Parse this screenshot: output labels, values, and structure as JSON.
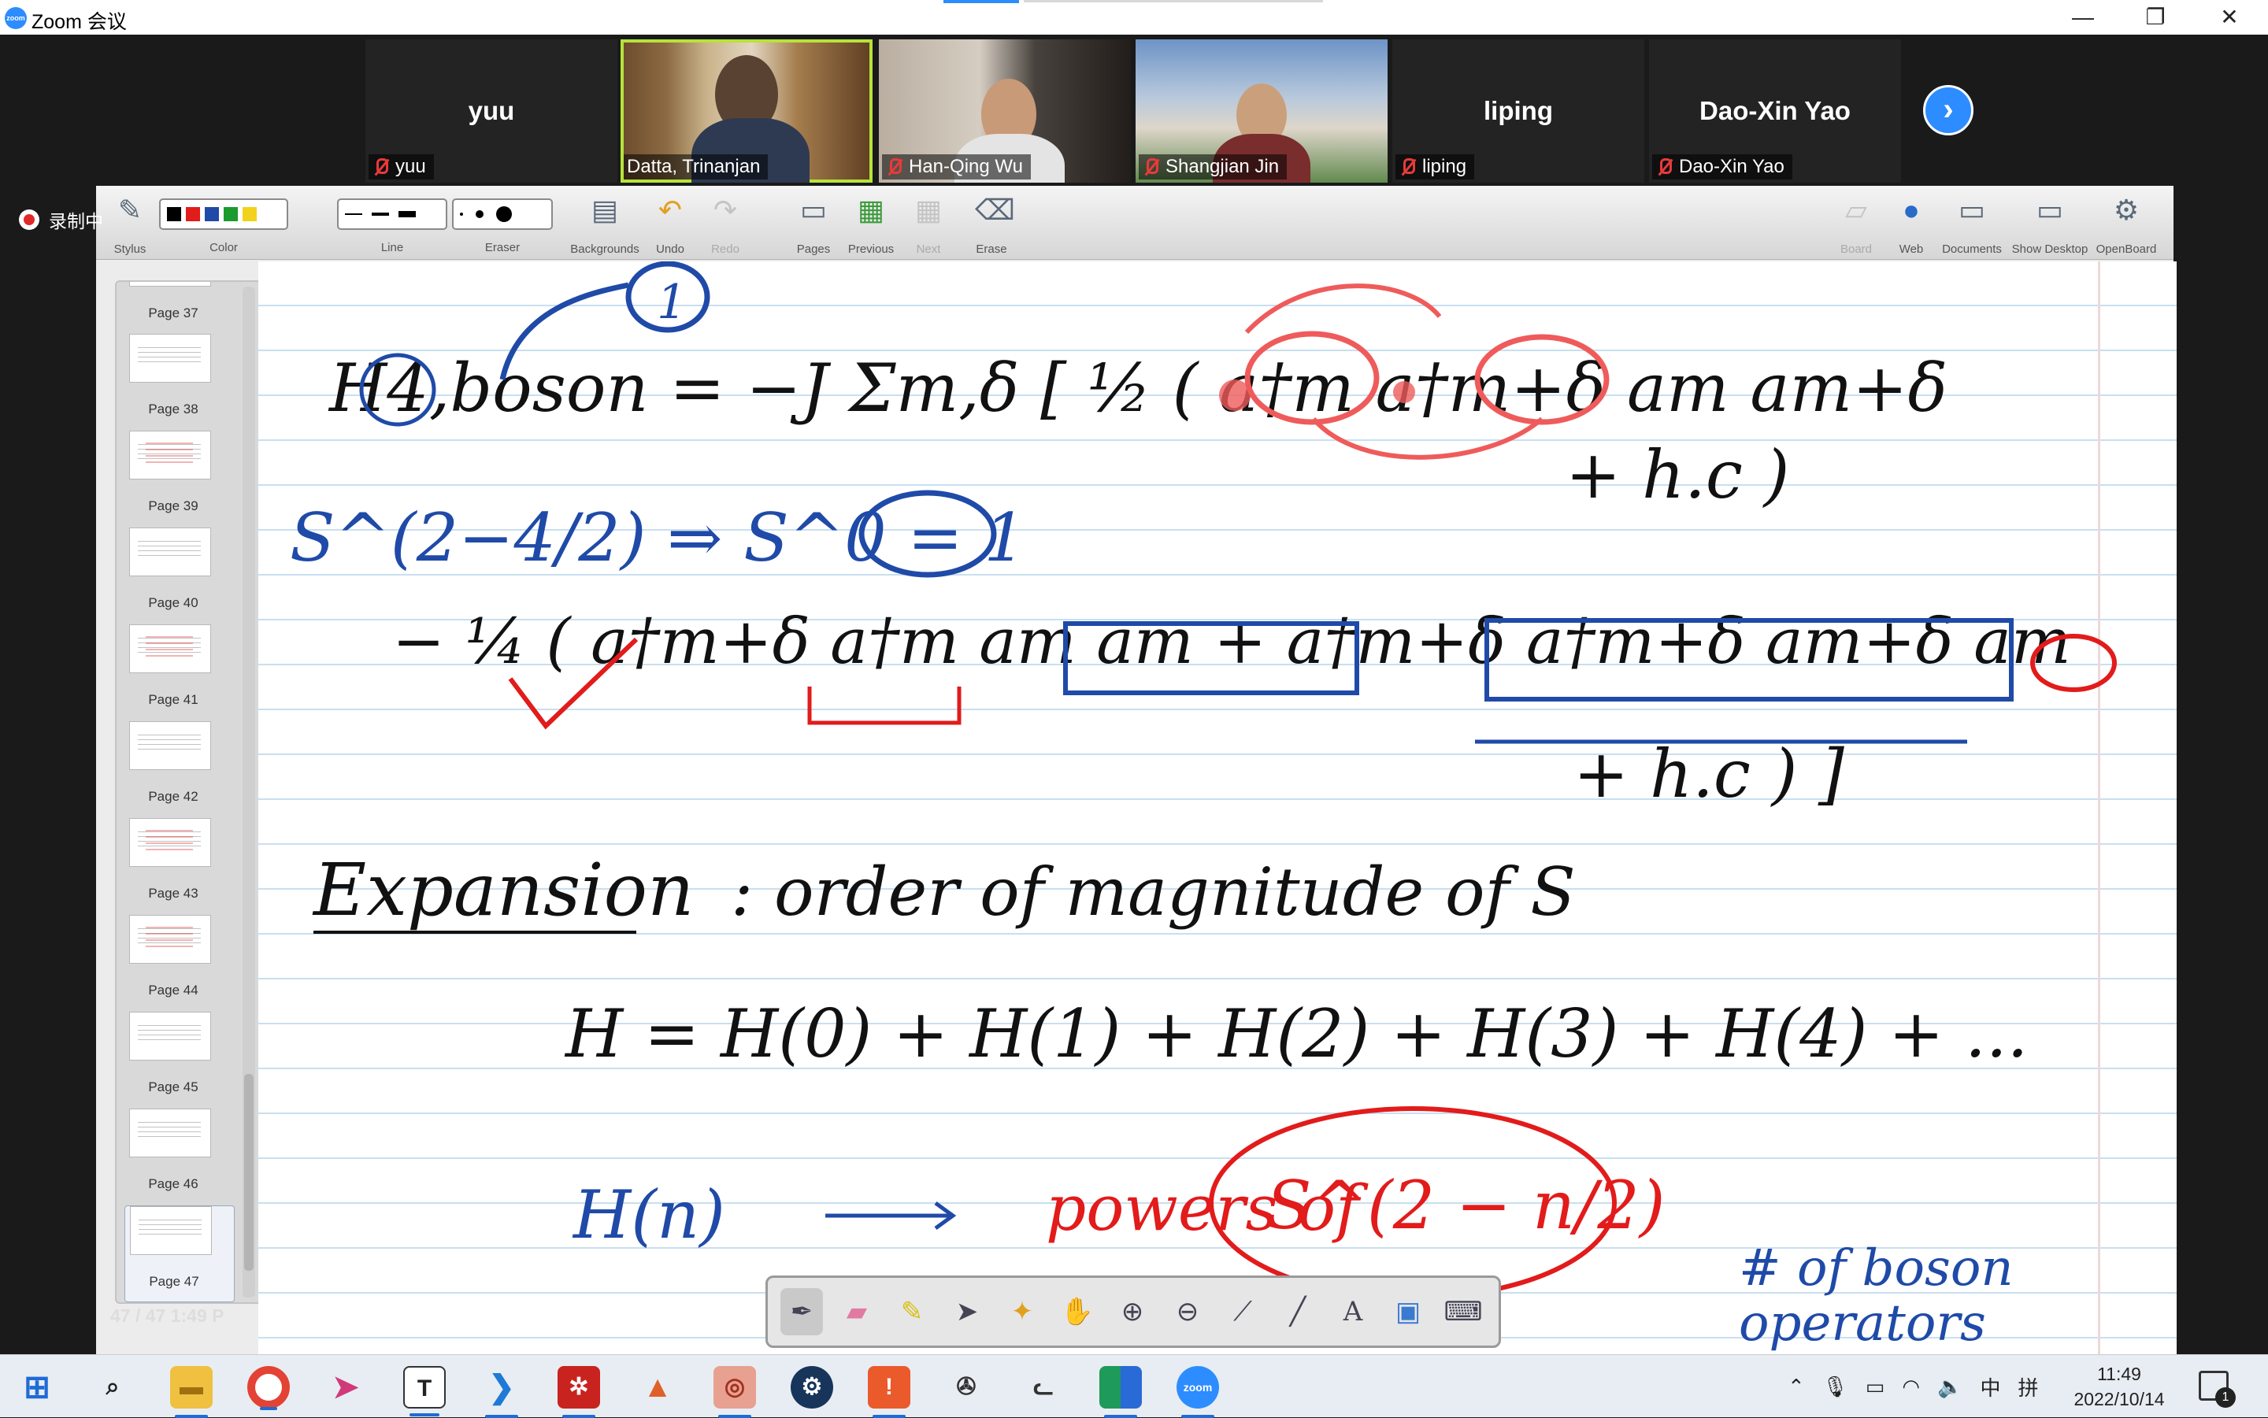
{
  "window": {
    "title": "Zoom 会议",
    "controls": [
      "—",
      "❐",
      "✕"
    ]
  },
  "participants": [
    {
      "name": "yuu",
      "label": "yuu",
      "video": false
    },
    {
      "name": "Datta, Trinanjan",
      "label": "Datta, Trinanjan",
      "video": true,
      "active": true
    },
    {
      "name": "Han-Qing Wu",
      "label": "Han-Qing Wu",
      "video": true
    },
    {
      "name": "Shangjian Jin",
      "label": "Shangjian Jin",
      "video": true
    },
    {
      "name": "liping",
      "label": "liping",
      "video": false
    },
    {
      "name": "Dao-Xin Yao",
      "label": "Dao-Xin Yao",
      "video": false
    }
  ],
  "next_icon": "chevron-right-icon",
  "recording": {
    "label": "录制中"
  },
  "toolbar": {
    "stylus": "Stylus",
    "color": "Color",
    "colors": [
      "#000000",
      "#e21b1b",
      "#1f4aa8",
      "#1b9a2e",
      "#f2d21b"
    ],
    "line": "Line",
    "eraser": "Eraser",
    "backgrounds": "Backgrounds",
    "undo": "Undo",
    "redo": "Redo",
    "pages": "Pages",
    "previous": "Previous",
    "next": "Next",
    "erase": "Erase",
    "board": "Board",
    "web": "Web",
    "documents": "Documents",
    "show_desktop": "Show Desktop",
    "openboard": "OpenBoard"
  },
  "pages": [
    {
      "label": "Page 37"
    },
    {
      "label": "Page 38"
    },
    {
      "label": "Page 39"
    },
    {
      "label": "Page 40"
    },
    {
      "label": "Page 41"
    },
    {
      "label": "Page 42"
    },
    {
      "label": "Page 43"
    },
    {
      "label": "Page 44"
    },
    {
      "label": "Page 45"
    },
    {
      "label": "Page 46"
    },
    {
      "label": "Page 47"
    }
  ],
  "page_indicator": "47 / 47 1:49 P",
  "whiteboard": {
    "line1": "H4,boson = −J Σm,δ [ ½ ( a†m a†m+δ am am+δ",
    "line1b": "+ h.c )",
    "line2": "S^(2−4/2) ⇒ S^0 = 1",
    "line3": "− ¼ ( a†m+δ a†m am am + a†m+δ a†m+δ am+δ am",
    "line3b": "+ h.c ) ]",
    "heading": "Expansion",
    "heading_rest": ": order of magnitude of S",
    "series": "H = H(0) + H(1) + H(2) + H(3) + H(4) + ...",
    "hn": "H(n)",
    "powers": "powers of",
    "circled": "S^(2 − n/2)",
    "note1": "# of boson",
    "note2": "operators"
  },
  "float_tools": [
    "pen-icon",
    "eraser-icon",
    "highlighter-icon",
    "pointer-icon",
    "laser-icon",
    "hand-icon",
    "zoom-in-icon",
    "zoom-out-icon",
    "color-picker-icon",
    "line-icon",
    "text-icon",
    "capture-icon",
    "keyboard-icon"
  ],
  "taskbar": {
    "apps": [
      "windows",
      "search",
      "file-explorer",
      "chrome",
      "app-pink",
      "typora",
      "vscode",
      "app-red",
      "matlab",
      "app-pdf",
      "steam",
      "app-orange",
      "app-wheel",
      "app-cat",
      "app-green",
      "zoom"
    ],
    "tray": {
      "ime1": "中",
      "ime2": "拼"
    },
    "time": "11:49",
    "date": "2022/10/14",
    "notifications": "1"
  }
}
